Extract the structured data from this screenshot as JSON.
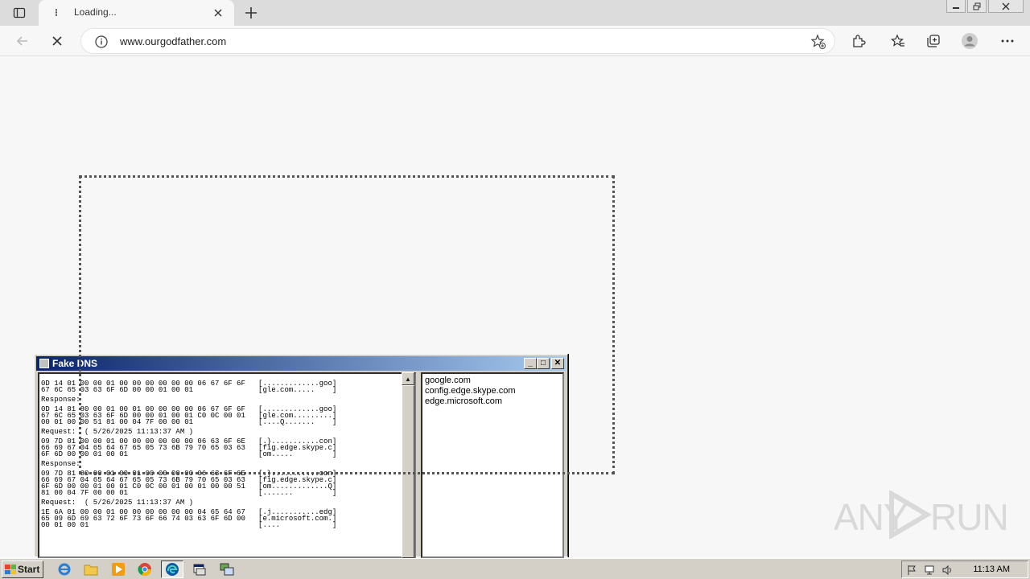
{
  "browser": {
    "tab_title": "Loading...",
    "url": "www.ourgodfather.com"
  },
  "fake_dns": {
    "title": "Fake DNS",
    "log_lines": [
      "0D 14 01 00 00 01 00 00 00 00 00 00 06 67 6F 6F   [.............goo]",
      "67 6C 65 03 63 6F 6D 00 00 01 00 01               [gle.com.....    ]",
      "",
      "Response:",
      "",
      "0D 14 81 80 00 01 00 01 00 00 00 00 06 67 6F 6F   [.............goo]",
      "67 6C 65 03 63 6F 6D 00 00 01 00 01 C0 0C 00 01   [gle.com.........]",
      "00 01 00 00 51 81 00 04 7F 00 00 01               [....Q.......    ]",
      "",
      "Request:  ( 5/26/2025 11:13:37 AM )",
      "",
      "09 7D 01 00 00 01 00 00 00 00 00 00 06 63 6F 6E   [.}...........con]",
      "66 69 67 04 65 64 67 65 05 73 6B 79 70 65 03 63   [fig.edge.skype.c]",
      "6F 6D 00 00 01 00 01                              [om.....         ]",
      "",
      "Response:",
      "",
      "09 7D 81 80 00 01 00 01 00 00 00 00 06 63 6F 6E   [.}...........con]",
      "66 69 67 04 65 64 67 65 05 73 6B 79 70 65 03 63   [fig.edge.skype.c]",
      "6F 6D 00 00 01 00 01 C0 0C 00 01 00 01 00 00 51   [om.............Q]",
      "81 00 04 7F 00 00 01                              [.......         ]",
      "",
      "Request:  ( 5/26/2025 11:13:37 AM )",
      "",
      "1E 6A 01 00 00 01 00 00 00 00 00 00 04 65 64 67   [.j...........edg]",
      "65 09 6D 69 63 72 6F 73 6F 66 74 03 63 6F 6D 00   [e.microsoft.com.]",
      "00 01 00 01                                       [....            ]"
    ],
    "domains": [
      "google.com",
      "config.edge.skype.com",
      "edge.microsoft.com"
    ]
  },
  "watermark": {
    "left": "ANY",
    "right": "RUN"
  },
  "taskbar": {
    "start_label": "Start",
    "clock": "11:13 AM"
  }
}
